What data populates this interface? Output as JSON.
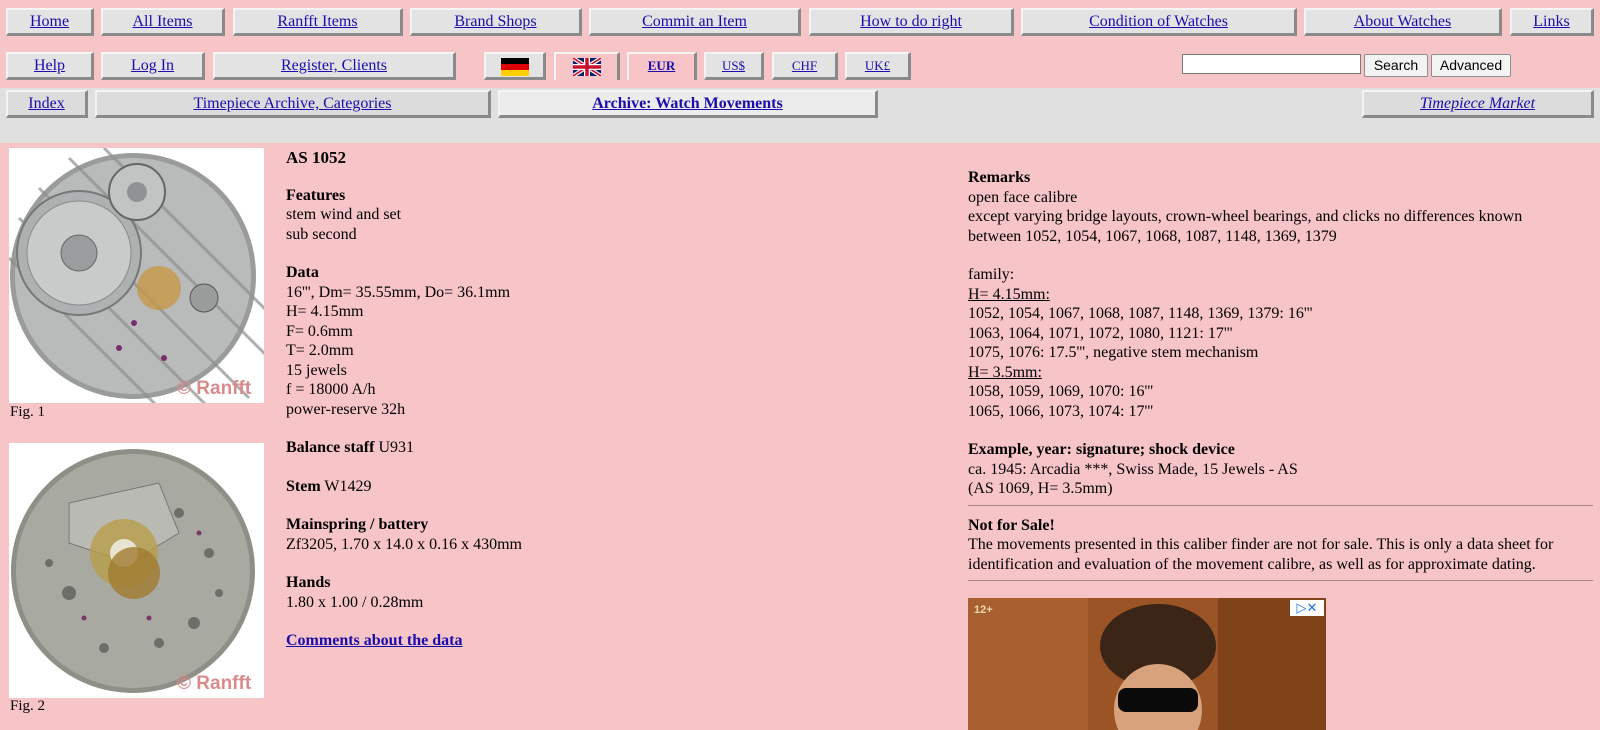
{
  "nav_row1": [
    "Home",
    "All Items",
    "Ranfft Items",
    "Brand Shops",
    "Commit an Item",
    "How to do right",
    "Condition of Watches",
    "About Watches",
    "Links"
  ],
  "nav_row2": {
    "help": "Help",
    "login": "Log In",
    "register": "Register, Clients",
    "currencies": [
      "EUR",
      "US$",
      "CHF",
      "UK£"
    ],
    "flags": [
      "german-flag-icon",
      "uk-flag-icon"
    ]
  },
  "search": {
    "value": "",
    "button": "Search",
    "advanced": "Advanced"
  },
  "nav_row3": {
    "index": "Index",
    "categories": "Timepiece Archive, Categories",
    "movements": "Archive: Watch Movements",
    "market": "Timepiece Market"
  },
  "figures": {
    "fig1": "Fig. 1",
    "fig2": "Fig. 2",
    "watermark": "© Ranfft"
  },
  "caliber": {
    "title": "AS 1052",
    "features_label": "Features",
    "features": [
      "stem wind and set",
      "sub second"
    ],
    "data_label": "Data",
    "data": [
      "16''', Dm= 35.55mm, Do= 36.1mm",
      "H= 4.15mm",
      "F= 0.6mm",
      "T= 2.0mm",
      "15 jewels",
      "f = 18000 A/h",
      "power-reserve 32h"
    ],
    "balance_label": "Balance staff",
    "balance": "U931",
    "stem_label": "Stem",
    "stem": "W1429",
    "mainspring_label": "Mainspring / battery",
    "mainspring": "Zf3205, 1.70 x 14.0 x 0.16 x 430mm",
    "hands_label": "Hands",
    "hands": "1.80 x 1.00 / 0.28mm",
    "comments_link": "Comments about the data"
  },
  "remarks": {
    "label": "Remarks",
    "lines": [
      "open face calibre",
      "except varying bridge layouts, crown-wheel bearings, and clicks no differences known",
      "between 1052, 1054, 1067, 1068, 1087, 1148, 1369, 1379"
    ],
    "family_label": "family:",
    "h1_label": "H= 4.15mm:",
    "h1_lines": [
      "1052, 1054, 1067, 1068, 1087, 1148, 1369, 1379: 16'''",
      "1063, 1064, 1071, 1072, 1080, 1121: 17'''",
      "1075, 1076: 17.5''', negative stem mechanism"
    ],
    "h2_label": "H= 3.5mm:",
    "h2_lines": [
      "1058, 1059, 1069, 1070: 16'''",
      "1065, 1066, 1073, 1074: 17'''"
    ],
    "example_label": "Example, year: signature; shock device",
    "example_lines": [
      "ca. 1945: Arcadia ***, Swiss Made, 15 Jewels - AS",
      "(AS 1069, H= 3.5mm)"
    ],
    "notsale_label": "Not for Sale!",
    "notsale_lines": [
      "The movements presented in this caliber finder are not for sale. This is only a data sheet for",
      "identification and evaluation of the movement calibre, as well as for approximate dating."
    ]
  },
  "ad": {
    "age": "12+"
  }
}
